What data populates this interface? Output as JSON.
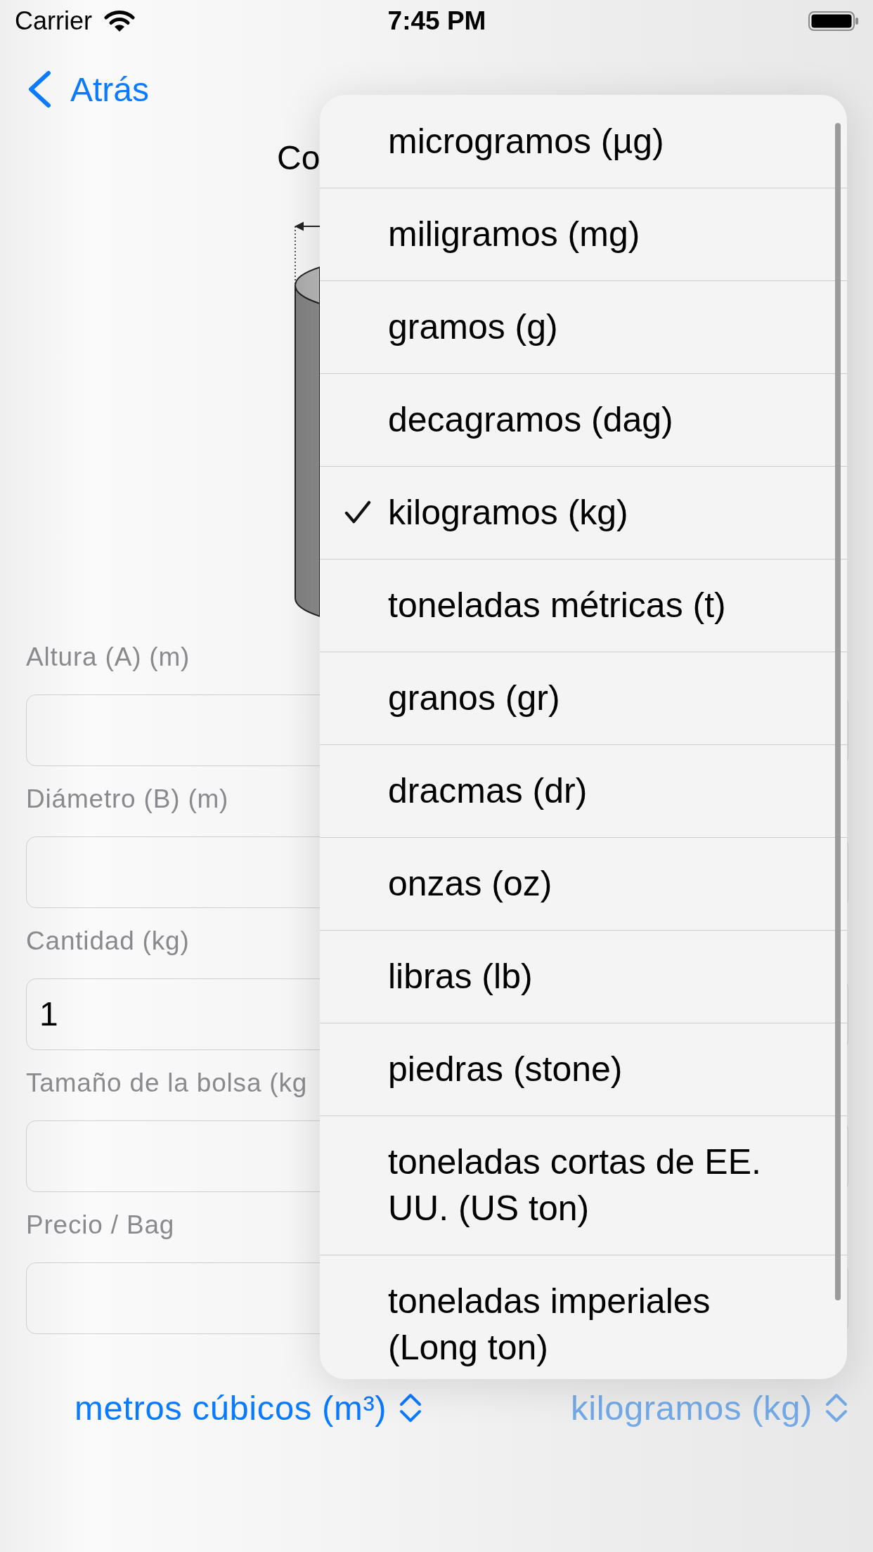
{
  "status_bar": {
    "carrier": "Carrier",
    "time": "7:45 PM"
  },
  "nav": {
    "back": "Atrás"
  },
  "title": "Co",
  "fields": [
    {
      "label": "Altura (A) (m)"
    },
    {
      "label": "Diámetro (B) (m)"
    },
    {
      "label": "Cantidad (kg)",
      "value": "1"
    },
    {
      "label": "Tamaño de la bolsa (kg"
    },
    {
      "label": "Precio / Bag"
    }
  ],
  "unit_menu": {
    "items": [
      {
        "label": "microgramos (µg)",
        "selected": false
      },
      {
        "label": "miligramos (mg)",
        "selected": false
      },
      {
        "label": "gramos (g)",
        "selected": false
      },
      {
        "label": "decagramos (dag)",
        "selected": false
      },
      {
        "label": "kilogramos (kg)",
        "selected": true
      },
      {
        "label": "toneladas métricas (t)",
        "selected": false
      },
      {
        "label": "granos (gr)",
        "selected": false
      },
      {
        "label": "dracmas (dr)",
        "selected": false
      },
      {
        "label": "onzas (oz)",
        "selected": false
      },
      {
        "label": "libras (lb)",
        "selected": false
      },
      {
        "label": "piedras (stone)",
        "selected": false
      },
      {
        "label": "toneladas cortas de EE. UU. (US ton)",
        "selected": false
      },
      {
        "label": "toneladas imperiales (Long ton)",
        "selected": false
      }
    ]
  },
  "unit_buttons": [
    {
      "label": "metros cúbicos (m³)",
      "dimmed": false
    },
    {
      "label": "kilogramos (kg)",
      "dimmed": true
    }
  ]
}
